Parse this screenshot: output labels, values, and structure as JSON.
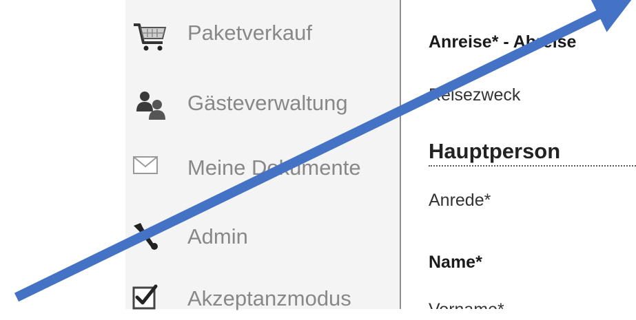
{
  "sidebar": {
    "items": [
      {
        "label": "Paketverkauf",
        "icon": "shopping-cart-icon"
      },
      {
        "label": "Gästeverwaltung",
        "icon": "users-icon"
      },
      {
        "label": "Meine Dokumente",
        "icon": "envelope-icon"
      },
      {
        "label": "Admin",
        "icon": "wrench-icon"
      },
      {
        "label": "Akzeptanzmodus",
        "icon": "checkbox-icon"
      }
    ]
  },
  "main": {
    "arrival_label": "Anreise* - Abreise",
    "purpose_label": "Reisezweck",
    "section_heading": "Hauptperson",
    "salutation_label": "Anrede*",
    "name_label": "Name*",
    "firstname_label": "Vorname*"
  },
  "colors": {
    "sidebar_bg": "#f4f4f4",
    "sidebar_text": "#888888",
    "annotation_arrow": "#4472c4"
  }
}
